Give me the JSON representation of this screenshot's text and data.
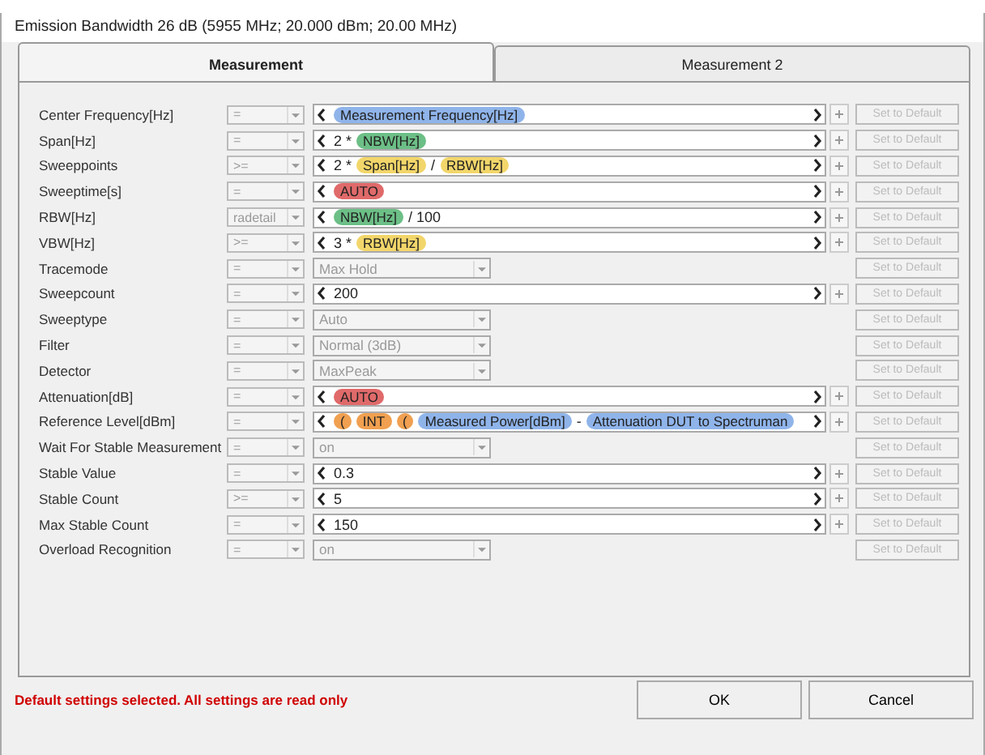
{
  "window": {
    "title": "Emission Bandwidth 26 dB (5955 MHz; 20.000 dBm; 20.00 MHz)"
  },
  "tabs": [
    {
      "label": "Measurement",
      "selected": true
    },
    {
      "label": "Measurement 2",
      "selected": false
    }
  ],
  "rows": [
    {
      "label": "Center Frequency[Hz]",
      "operator": {
        "value": "=",
        "disabled": true
      },
      "kind": "expr",
      "tokens": [
        {
          "kind": "chip",
          "text": "Measurement Frequency[Hz]",
          "color": "#8fb4ea"
        }
      ],
      "default_button": {
        "label": "Set to Default",
        "disabled": true
      }
    },
    {
      "label": "Span[Hz]",
      "operator": {
        "value": "=",
        "disabled": true
      },
      "kind": "expr",
      "tokens": [
        {
          "kind": "text",
          "text": "2 *"
        },
        {
          "kind": "chip",
          "text": "NBW[Hz]",
          "color": "#6cbf86"
        }
      ],
      "default_button": {
        "label": "Set to Default",
        "disabled": true
      }
    },
    {
      "label": "Sweeppoints",
      "operator": {
        "value": ">=",
        "disabled": true
      },
      "kind": "expr",
      "tokens": [
        {
          "kind": "text",
          "text": "2 *"
        },
        {
          "kind": "chip",
          "text": "Span[Hz]",
          "color": "#f2d66a"
        },
        {
          "kind": "text",
          "text": "/"
        },
        {
          "kind": "chip",
          "text": "RBW[Hz]",
          "color": "#f2d66a"
        }
      ],
      "default_button": {
        "label": "Set to Default",
        "disabled": true
      }
    },
    {
      "label": "Sweeptime[s]",
      "operator": {
        "value": "=",
        "disabled": true
      },
      "kind": "expr",
      "tokens": [
        {
          "kind": "chip",
          "text": "AUTO",
          "color": "#e06a6a"
        }
      ],
      "default_button": {
        "label": "Set to Default",
        "disabled": true
      }
    },
    {
      "label": "RBW[Hz]",
      "operator": {
        "value": "radetail",
        "disabled": true
      },
      "kind": "expr",
      "tokens": [
        {
          "kind": "chip",
          "text": "NBW[Hz]",
          "color": "#6cbf86"
        },
        {
          "kind": "text",
          "text": "/ 100"
        }
      ],
      "default_button": {
        "label": "Set to Default",
        "disabled": true
      }
    },
    {
      "label": "VBW[Hz]",
      "operator": {
        "value": ">=",
        "disabled": true
      },
      "kind": "expr",
      "tokens": [
        {
          "kind": "text",
          "text": "3 *"
        },
        {
          "kind": "chip",
          "text": "RBW[Hz]",
          "color": "#f2d66a"
        }
      ],
      "default_button": {
        "label": "Set to Default",
        "disabled": true
      }
    },
    {
      "label": "Tracemode",
      "operator": {
        "value": "=",
        "disabled": true
      },
      "kind": "select",
      "value": "Max Hold",
      "default_button": {
        "label": "Set to Default",
        "disabled": true
      }
    },
    {
      "label": "Sweepcount",
      "operator": {
        "value": "=",
        "disabled": true
      },
      "kind": "expr",
      "tokens": [
        {
          "kind": "text",
          "text": "200"
        }
      ],
      "default_button": {
        "label": "Set to Default",
        "disabled": true
      }
    },
    {
      "label": "Sweeptype",
      "operator": {
        "value": "=",
        "disabled": true
      },
      "kind": "select",
      "value": "Auto",
      "default_button": {
        "label": "Set to Default",
        "disabled": true
      }
    },
    {
      "label": "Filter",
      "operator": {
        "value": "=",
        "disabled": true
      },
      "kind": "select",
      "value": "Normal (3dB)",
      "default_button": {
        "label": "Set to Default",
        "disabled": true
      }
    },
    {
      "label": "Detector",
      "operator": {
        "value": "=",
        "disabled": true
      },
      "kind": "select",
      "value": "MaxPeak",
      "default_button": {
        "label": "Set to Default",
        "disabled": true
      }
    },
    {
      "label": "Attenuation[dB]",
      "operator": {
        "value": "=",
        "disabled": true
      },
      "kind": "expr",
      "tokens": [
        {
          "kind": "chip",
          "text": "AUTO",
          "color": "#e06a6a"
        }
      ],
      "default_button": {
        "label": "Set to Default",
        "disabled": true
      }
    },
    {
      "label": "Reference Level[dBm]",
      "operator": {
        "value": "=",
        "disabled": true
      },
      "kind": "expr",
      "tokens": [
        {
          "kind": "chip",
          "text": "(",
          "color": "#f0a050"
        },
        {
          "kind": "chip",
          "text": "INT",
          "color": "#f0a050"
        },
        {
          "kind": "chip",
          "text": "(",
          "color": "#f0a050"
        },
        {
          "kind": "chip",
          "text": "Measured Power[dBm]",
          "color": "#8fb4ea"
        },
        {
          "kind": "text",
          "text": "-"
        },
        {
          "kind": "chip",
          "text": "Attenuation DUT to Spectruman",
          "color": "#8fb4ea"
        }
      ],
      "default_button": {
        "label": "Set to Default",
        "disabled": true
      }
    },
    {
      "label": "Wait For Stable Measurement",
      "operator": {
        "value": "=",
        "disabled": true
      },
      "kind": "select",
      "value": "on",
      "default_button": {
        "label": "Set to Default",
        "disabled": true
      }
    },
    {
      "label": "Stable Value",
      "operator": {
        "value": "=",
        "disabled": true
      },
      "kind": "expr",
      "tokens": [
        {
          "kind": "text",
          "text": "0.3"
        }
      ],
      "default_button": {
        "label": "Set to Default",
        "disabled": true
      }
    },
    {
      "label": "Stable Count",
      "operator": {
        "value": ">=",
        "disabled": true
      },
      "kind": "expr",
      "tokens": [
        {
          "kind": "text",
          "text": "5"
        }
      ],
      "default_button": {
        "label": "Set to Default",
        "disabled": true
      }
    },
    {
      "label": "Max Stable Count",
      "operator": {
        "value": "=",
        "disabled": true
      },
      "kind": "expr",
      "tokens": [
        {
          "kind": "text",
          "text": "150"
        }
      ],
      "default_button": {
        "label": "Set to Default",
        "disabled": true
      }
    },
    {
      "label": "Overload Recognition",
      "operator": {
        "value": "=",
        "disabled": true
      },
      "kind": "select",
      "value": "on",
      "default_button": {
        "label": "Set to Default",
        "disabled": true
      }
    }
  ],
  "status_message": "Default settings selected. All settings are read only",
  "buttons": [
    {
      "label": "OK"
    },
    {
      "label": "Cancel"
    }
  ]
}
